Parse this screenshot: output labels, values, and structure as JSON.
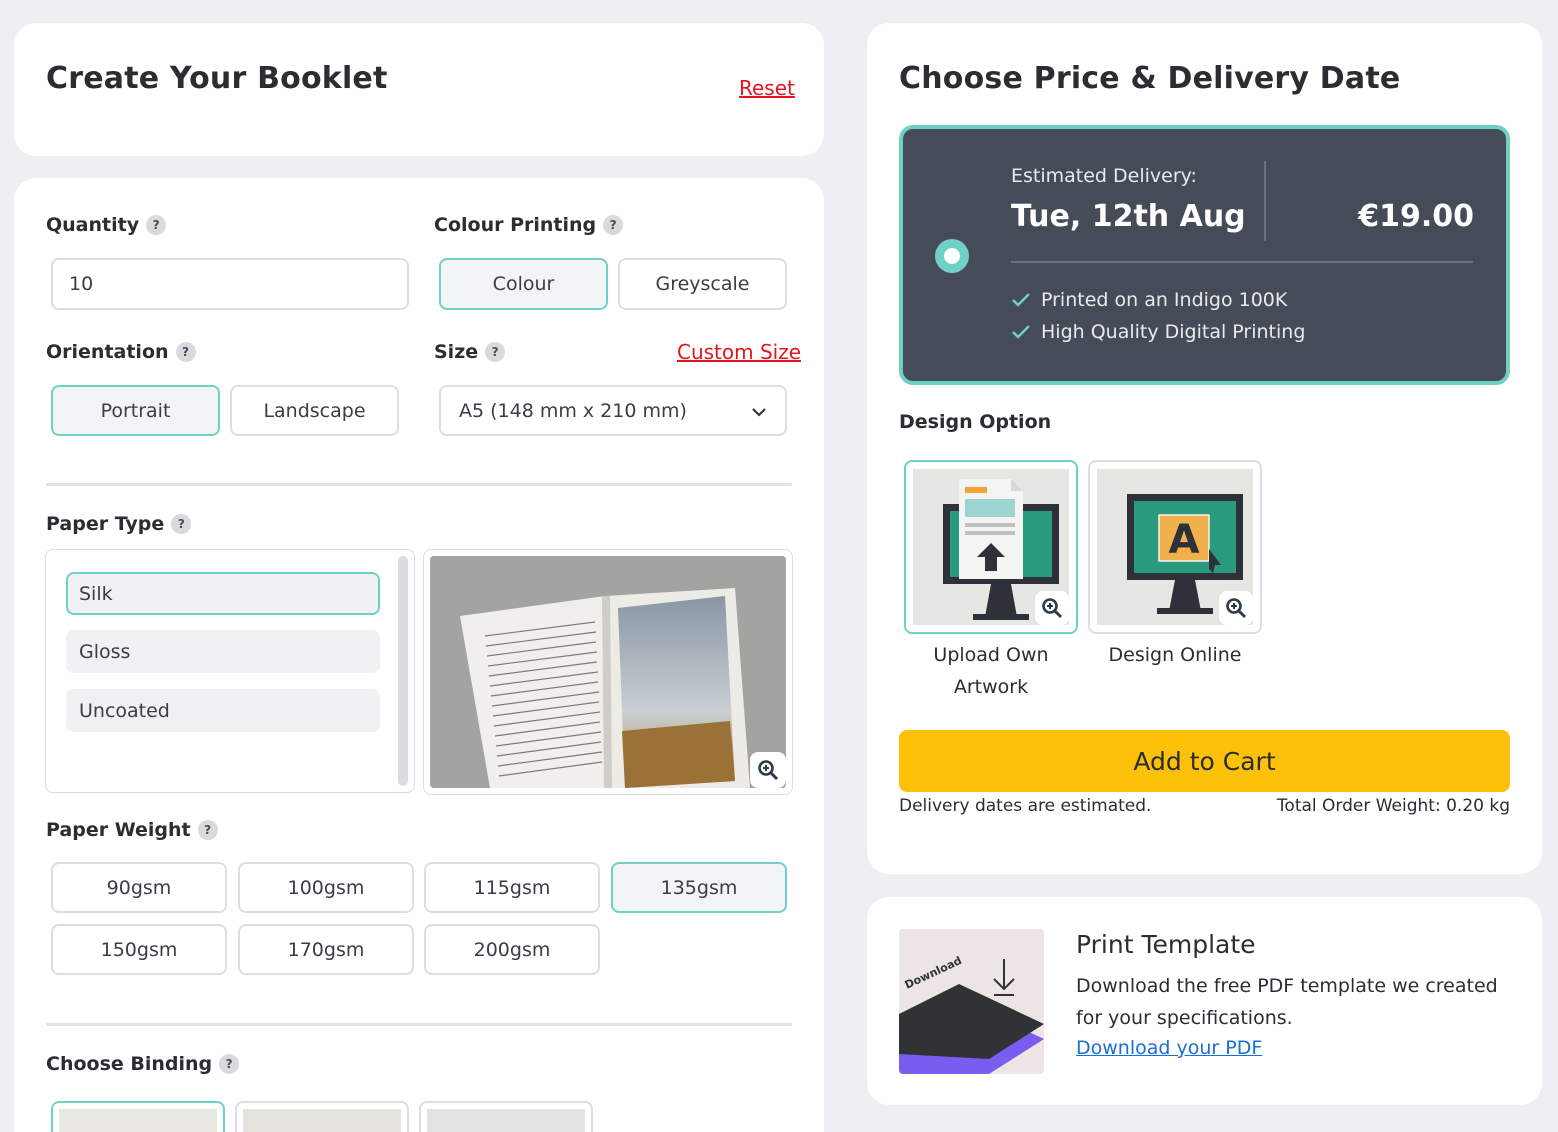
{
  "booklet_header": {
    "title": "Create Your Booklet",
    "reset_label": "Reset"
  },
  "quantity": {
    "label": "Quantity",
    "help": "?",
    "value": "10"
  },
  "colour_printing": {
    "label": "Colour Printing",
    "help": "?",
    "options": [
      "Colour",
      "Greyscale"
    ],
    "selected": "Colour"
  },
  "orientation": {
    "label": "Orientation",
    "help": "?",
    "options": [
      "Portrait",
      "Landscape"
    ],
    "selected": "Portrait"
  },
  "size": {
    "label": "Size",
    "help": "?",
    "custom_label": "Custom Size",
    "selected": "A5 (148 mm x 210 mm)"
  },
  "paper_type": {
    "label": "Paper Type",
    "help": "?",
    "options": [
      "Silk",
      "Gloss",
      "Uncoated"
    ],
    "selected": "Silk"
  },
  "paper_weight": {
    "label": "Paper Weight",
    "help": "?",
    "options": [
      "90gsm",
      "100gsm",
      "115gsm",
      "135gsm",
      "150gsm",
      "170gsm",
      "200gsm"
    ],
    "selected": "135gsm"
  },
  "binding": {
    "label": "Choose Binding",
    "help": "?"
  },
  "price": {
    "title": "Choose Price & Delivery Date",
    "delivery_label": "Estimated Delivery:",
    "delivery_date": "Tue, 12th Aug",
    "amount": "€19.00",
    "features": [
      "Printed on an Indigo 100K",
      "High Quality Digital Printing"
    ]
  },
  "design_option": {
    "label": "Design Option",
    "options": [
      "Upload Own Artwork",
      "Design Online"
    ],
    "option_lines": [
      [
        "Upload Own",
        "Artwork"
      ],
      [
        "Design Online"
      ]
    ],
    "selected": "Upload Own Artwork"
  },
  "cart": {
    "button_label": "Add to Cart",
    "delivery_note": "Delivery dates are estimated.",
    "weight_note": "Total Order Weight: 0.20 kg"
  },
  "template": {
    "title": "Print Template",
    "description_lines": [
      "Download the free PDF template we created",
      "for your specifications."
    ],
    "link_label": "Download your PDF",
    "thumb_text": "Download"
  },
  "colors": {
    "accent": "#6fd0c6",
    "cart": "#fdc10a",
    "dark_panel": "#454c58",
    "red": "#e4151b",
    "link": "#1a6fd4"
  },
  "icons": {
    "help": "question-mark-icon",
    "zoom": "zoom-in-icon",
    "chevron": "chevron-down-icon",
    "check": "check-icon"
  }
}
